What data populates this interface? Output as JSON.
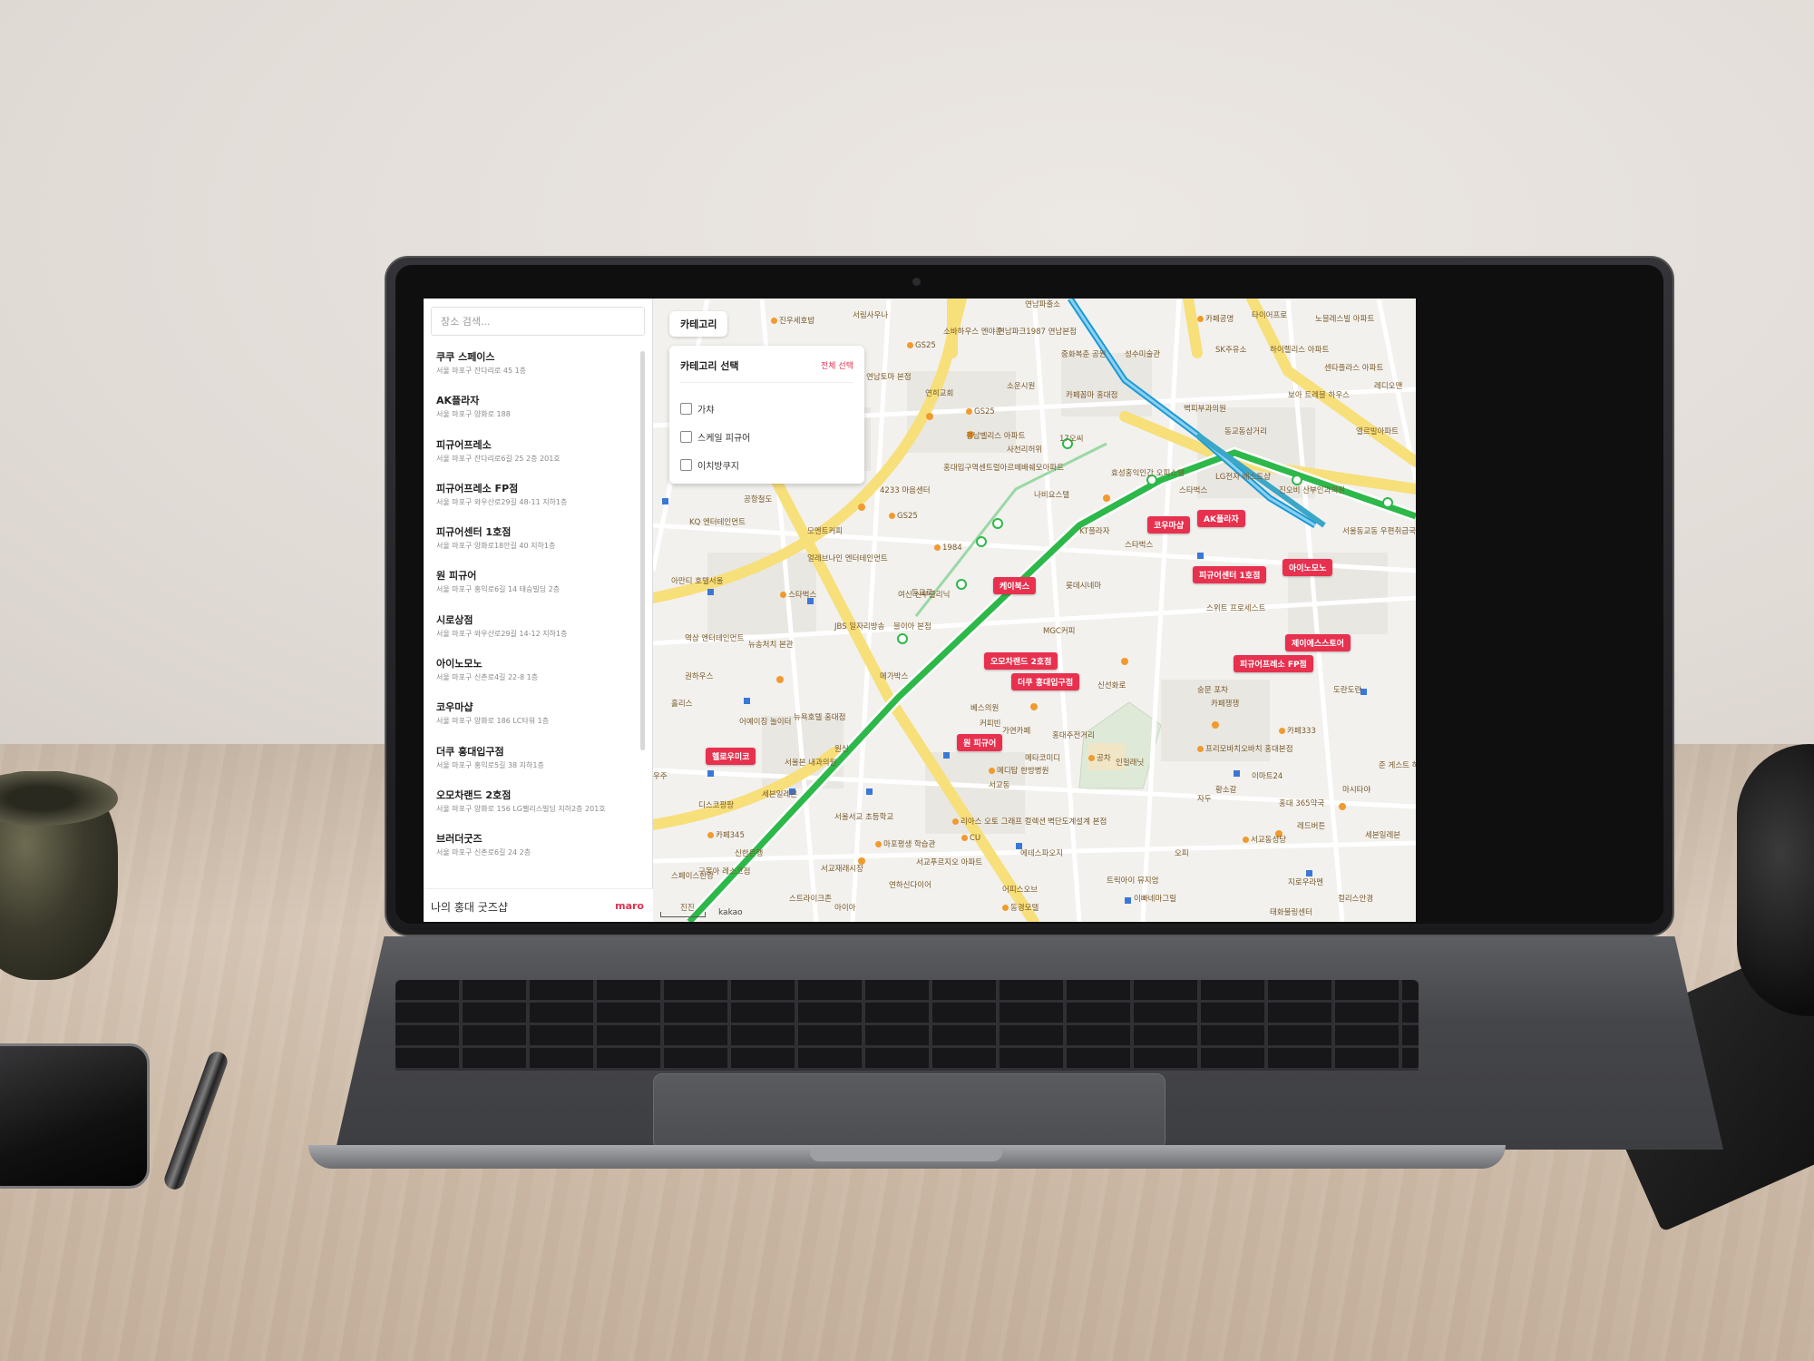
{
  "app": {
    "search_placeholder": "장소 검색...",
    "footer_title": "나의 홍대 굿즈샵",
    "footer_logo": "maro"
  },
  "places": [
    {
      "name": "쿠쿠 스페이스",
      "address": "서울 마포구 잔다리로 45 1층"
    },
    {
      "name": "AK플라자",
      "address": "서울 마포구 양화로 188"
    },
    {
      "name": "피규어프레소",
      "address": "서울 마포구 잔다리로6길 25 2층 201호"
    },
    {
      "name": "피규어프레소 FP점",
      "address": "서울 마포구 와우산로29길 48-11 지하1층"
    },
    {
      "name": "피규어센터 1호점",
      "address": "서울 마포구 양화로18안길 40 지하1층"
    },
    {
      "name": "원 피규어",
      "address": "서울 마포구 홍익로6길 14 태승빌딩 2층"
    },
    {
      "name": "시로상점",
      "address": "서울 마포구 와우산로29길 14-12 지하1층"
    },
    {
      "name": "아이노모노",
      "address": "서울 마포구 신촌로4길 22-8 1층"
    },
    {
      "name": "코우마샵",
      "address": "서울 마포구 양화로 186 LC타워 1층"
    },
    {
      "name": "더쿠 홍대입구점",
      "address": "서울 마포구 홍익로5길 38 지하1층"
    },
    {
      "name": "오모차랜드 2호점",
      "address": "서울 마포구 양화로 156 LG팰리스빌딩 지하2층 201호"
    },
    {
      "name": "브러더굿즈",
      "address": "서울 마포구 신촌로6길 24 2층"
    }
  ],
  "map": {
    "category_tab": "카테고리",
    "panel_title": "카테고리 선택",
    "panel_select_all": "전체 선택",
    "categories": [
      "가챠",
      "스케일 피규어",
      "이치방쿠지"
    ],
    "attribution": "kakao",
    "markers": [
      "코우마샵",
      "AK플라자",
      "케이북스",
      "피규어센터 1호점",
      "아이노모노",
      "제이에스스토어",
      "오모차랜드 2호점",
      "더쿠 홍대입구점",
      "피규어프레소 FP점",
      "원 피규어",
      "헬로우미코"
    ],
    "pois": [
      "연남파출소",
      "진우세호밥",
      "서림사우나",
      "GS25",
      "소바하우스 멘야준",
      "연남파크1987 연남본점",
      "카페공명",
      "타이어프로",
      "노블레스빌 아파트",
      "연남토마 본점",
      "연희교회",
      "중화복춘 공원",
      "성수미술관",
      "SK주유소",
      "하이렐리스 아파트",
      "소운시원",
      "GS25",
      "카페꼼마 홍대점",
      "센타플라스 아파트",
      "보아 트레블 하우스",
      "레디오맨",
      "경남벨리스 아파트",
      "17오씨",
      "사천리허위",
      "벽피부과의원",
      "동교동삼거리",
      "엘르빌아파트",
      "홍대입구역센트럴아르떼배쉐모아파트",
      "효성홍익인간 오피스텔",
      "LG전자 베스트샵",
      "4233 마음센터",
      "GS25",
      "나비요스텔",
      "KQ 엔터테인먼트",
      "공항철도",
      "모멘트커피",
      "KT플라자",
      "진오비 산부인과의원",
      "서울동교동 우편취급국",
      "아만티 호텔서울",
      "얼레브나인 엔터테인먼트",
      "1984",
      "스타벅스",
      "스타벅스",
      "스타벅스",
      "롯데시네마",
      "여신 신부클리닉",
      "스위트 프로세스트",
      "JBS 일자리방송",
      "블이아 본점",
      "MGC커피",
      "동교로",
      "메가박스",
      "역삼 엔터테인먼트",
      "뉴송처치 본관",
      "신선화로",
      "숭문 포차",
      "카페쟁쟁",
      "도란도란",
      "권하우스",
      "뉴욕호텔 홍대점",
      "베스의원",
      "커피빈",
      "카페333",
      "홀리스",
      "어예이징 놀이터",
      "가연카페",
      "홍대주전거리",
      "원신",
      "서울본 내과의원",
      "세븐일레븐",
      "메디탑 한방병원",
      "공차",
      "이마트24",
      "메타코미디",
      "서교동",
      "프리모바치오바치 홍대본점",
      "황소갈",
      "마시타야",
      "자두",
      "홍대 365약국",
      "준 게스트 하우스",
      "우주",
      "디스코팡팡",
      "인헐래닛",
      "서울서교 초등학교",
      "리아스 오토 그래프 컬렉션",
      "카페345",
      "CU",
      "레드버튼",
      "세본일레븐",
      "구몽아 레스코점",
      "신한은행",
      "벽단도계설계 본점",
      "마포평생 학습관",
      "오피",
      "서교동성당",
      "에테스파오지",
      "서교푸르지오 아파트",
      "서교재래시장",
      "연하신다이어",
      "트릭아이 뮤지엄",
      "지로우라멘",
      "컬리스안경",
      "어피스오브",
      "스트라이크존",
      "아이아",
      "동경모텔",
      "이빠네마그릴",
      "태화불링센터",
      "스페이스한강",
      "진진",
      "스타벅스"
    ]
  },
  "colors": {
    "accent": "#e8314f",
    "subway_green": "#2db84a",
    "road_yellow": "#f7df7a",
    "airport_rail": "#1a9ad6"
  }
}
